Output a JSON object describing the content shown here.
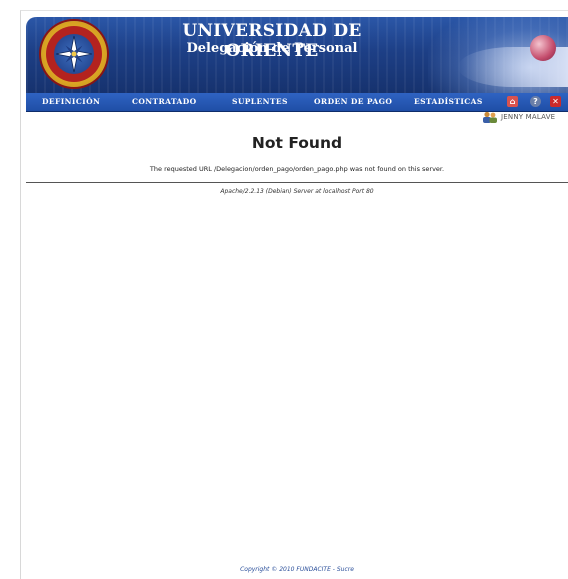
{
  "header": {
    "title": "UNIVERSIDAD DE ORIENTE",
    "subtitle": "Delegación de Personal",
    "seal_icon": "university-seal-icon"
  },
  "menu": {
    "items": [
      {
        "label": "DEFINICIÓN"
      },
      {
        "label": "CONTRATADO"
      },
      {
        "label": "SUPLENTES"
      },
      {
        "label": "ORDEN DE PAGO"
      },
      {
        "label": "ESTADÍSTICAS"
      }
    ],
    "tools": [
      {
        "icon": "home-icon",
        "glyph": "⌂",
        "color": "#d9534f"
      },
      {
        "icon": "help-icon",
        "glyph": "?",
        "color": "#6b7fa8"
      },
      {
        "icon": "close-icon",
        "glyph": "✕",
        "color": "#cc2a2a"
      }
    ]
  },
  "user": {
    "name": "JENNY MALAVE",
    "icon": "users-icon"
  },
  "error": {
    "title": "Not Found",
    "message": "The requested URL /Delegacion/orden_pago/orden_pago.php was not found on this server.",
    "address": "Apache/2.2.13 (Debian) Server at localhost Port 80"
  },
  "footer": {
    "copyright": "Copyright © 2010 FUNDACITE - Sucre"
  }
}
